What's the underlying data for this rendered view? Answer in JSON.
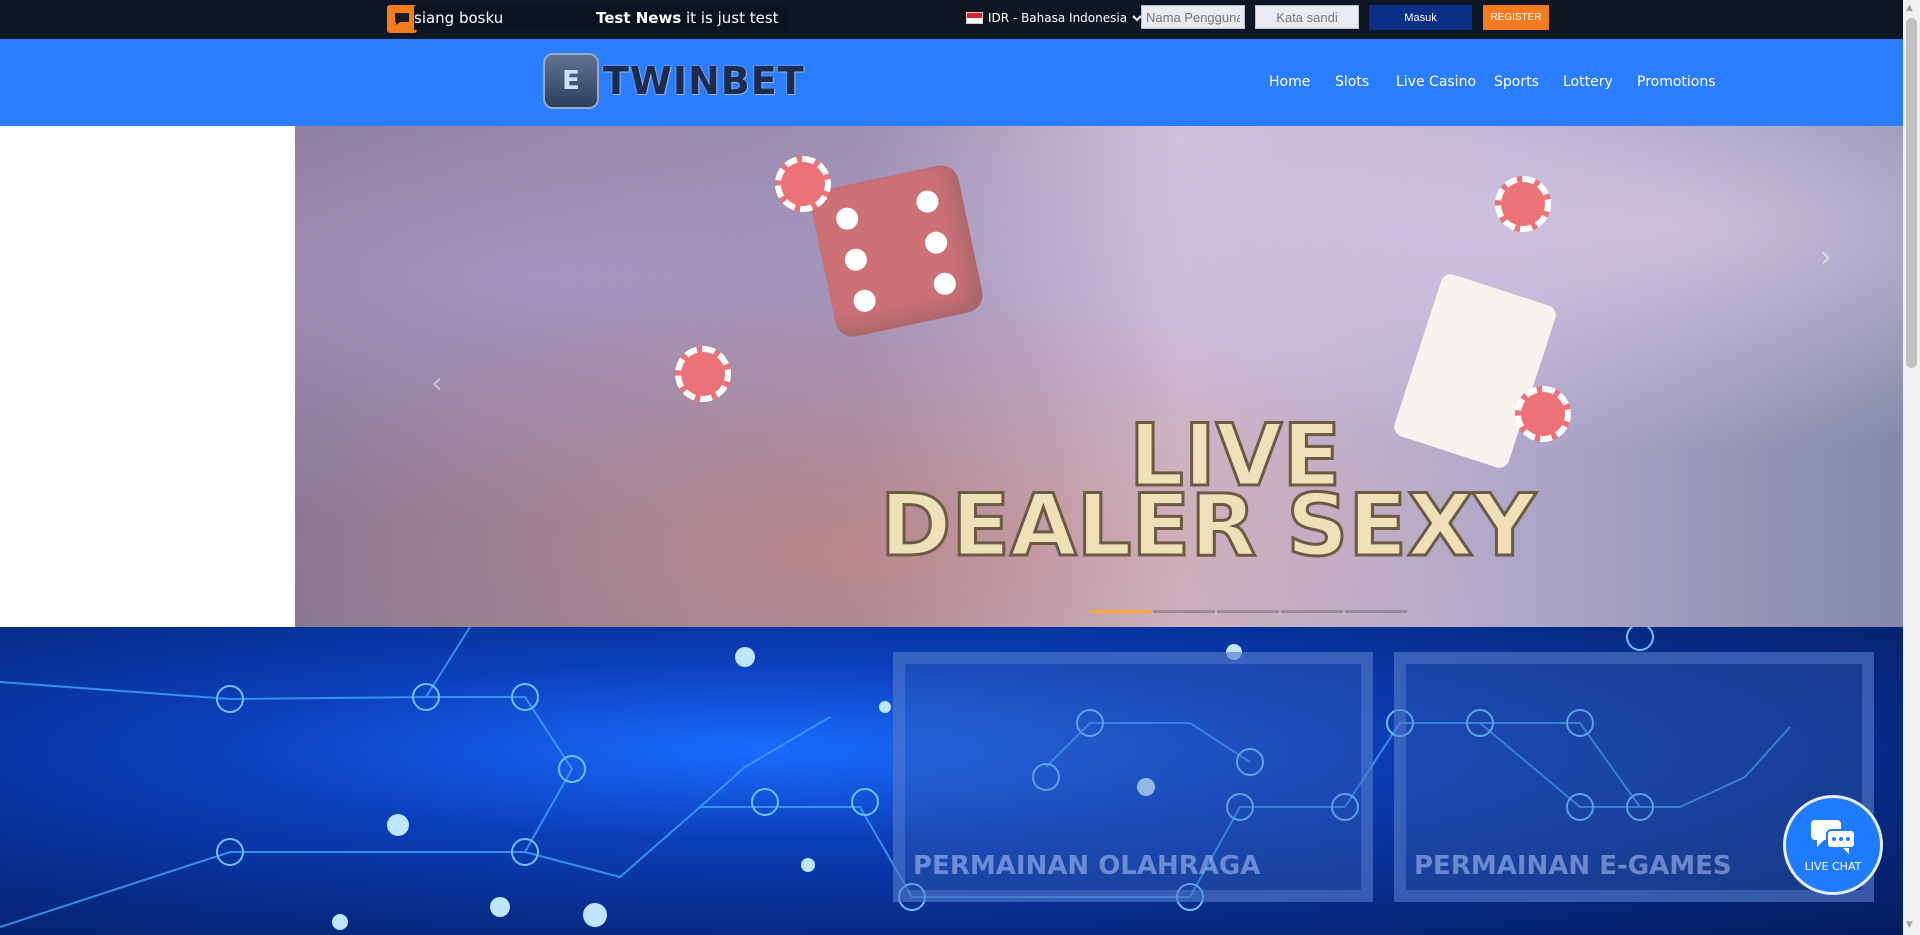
{
  "topbar": {
    "news_ticker": [
      {
        "prefix": "",
        "text": "siang bosku"
      },
      {
        "prefix": "Test News",
        "text": " it is just test"
      }
    ],
    "language": "IDR - Bahasa Indonesia",
    "username_placeholder": "Nama Pengguna",
    "password_placeholder": "Kata sandi",
    "login_label": "Masuk",
    "register_label": "REGISTER"
  },
  "header": {
    "logo_text": "TWINBET",
    "logo_mark": "E",
    "nav": [
      "Home",
      "Slots",
      "Live Casino",
      "Sports",
      "Lottery",
      "Promotions"
    ]
  },
  "banner": {
    "title_line1": "LIVE",
    "title_line2": "DEALER SEXY",
    "slide_count": 5,
    "active_slide": 1
  },
  "games": [
    {
      "label": "PERMAINAN OLAHRAGA"
    },
    {
      "label": "PERMAINAN E-GAMES"
    }
  ],
  "livechat": {
    "label": "LIVE CHAT"
  },
  "colors": {
    "topbar": "#0e1623",
    "header": "#2a7dff",
    "accent": "#f47b20",
    "login": "#0b2e86"
  },
  "icons": [
    "chat-icon",
    "flag-icon",
    "chevron-down-icon",
    "chevron-left-icon",
    "chevron-right-icon",
    "livechat-icon"
  ]
}
